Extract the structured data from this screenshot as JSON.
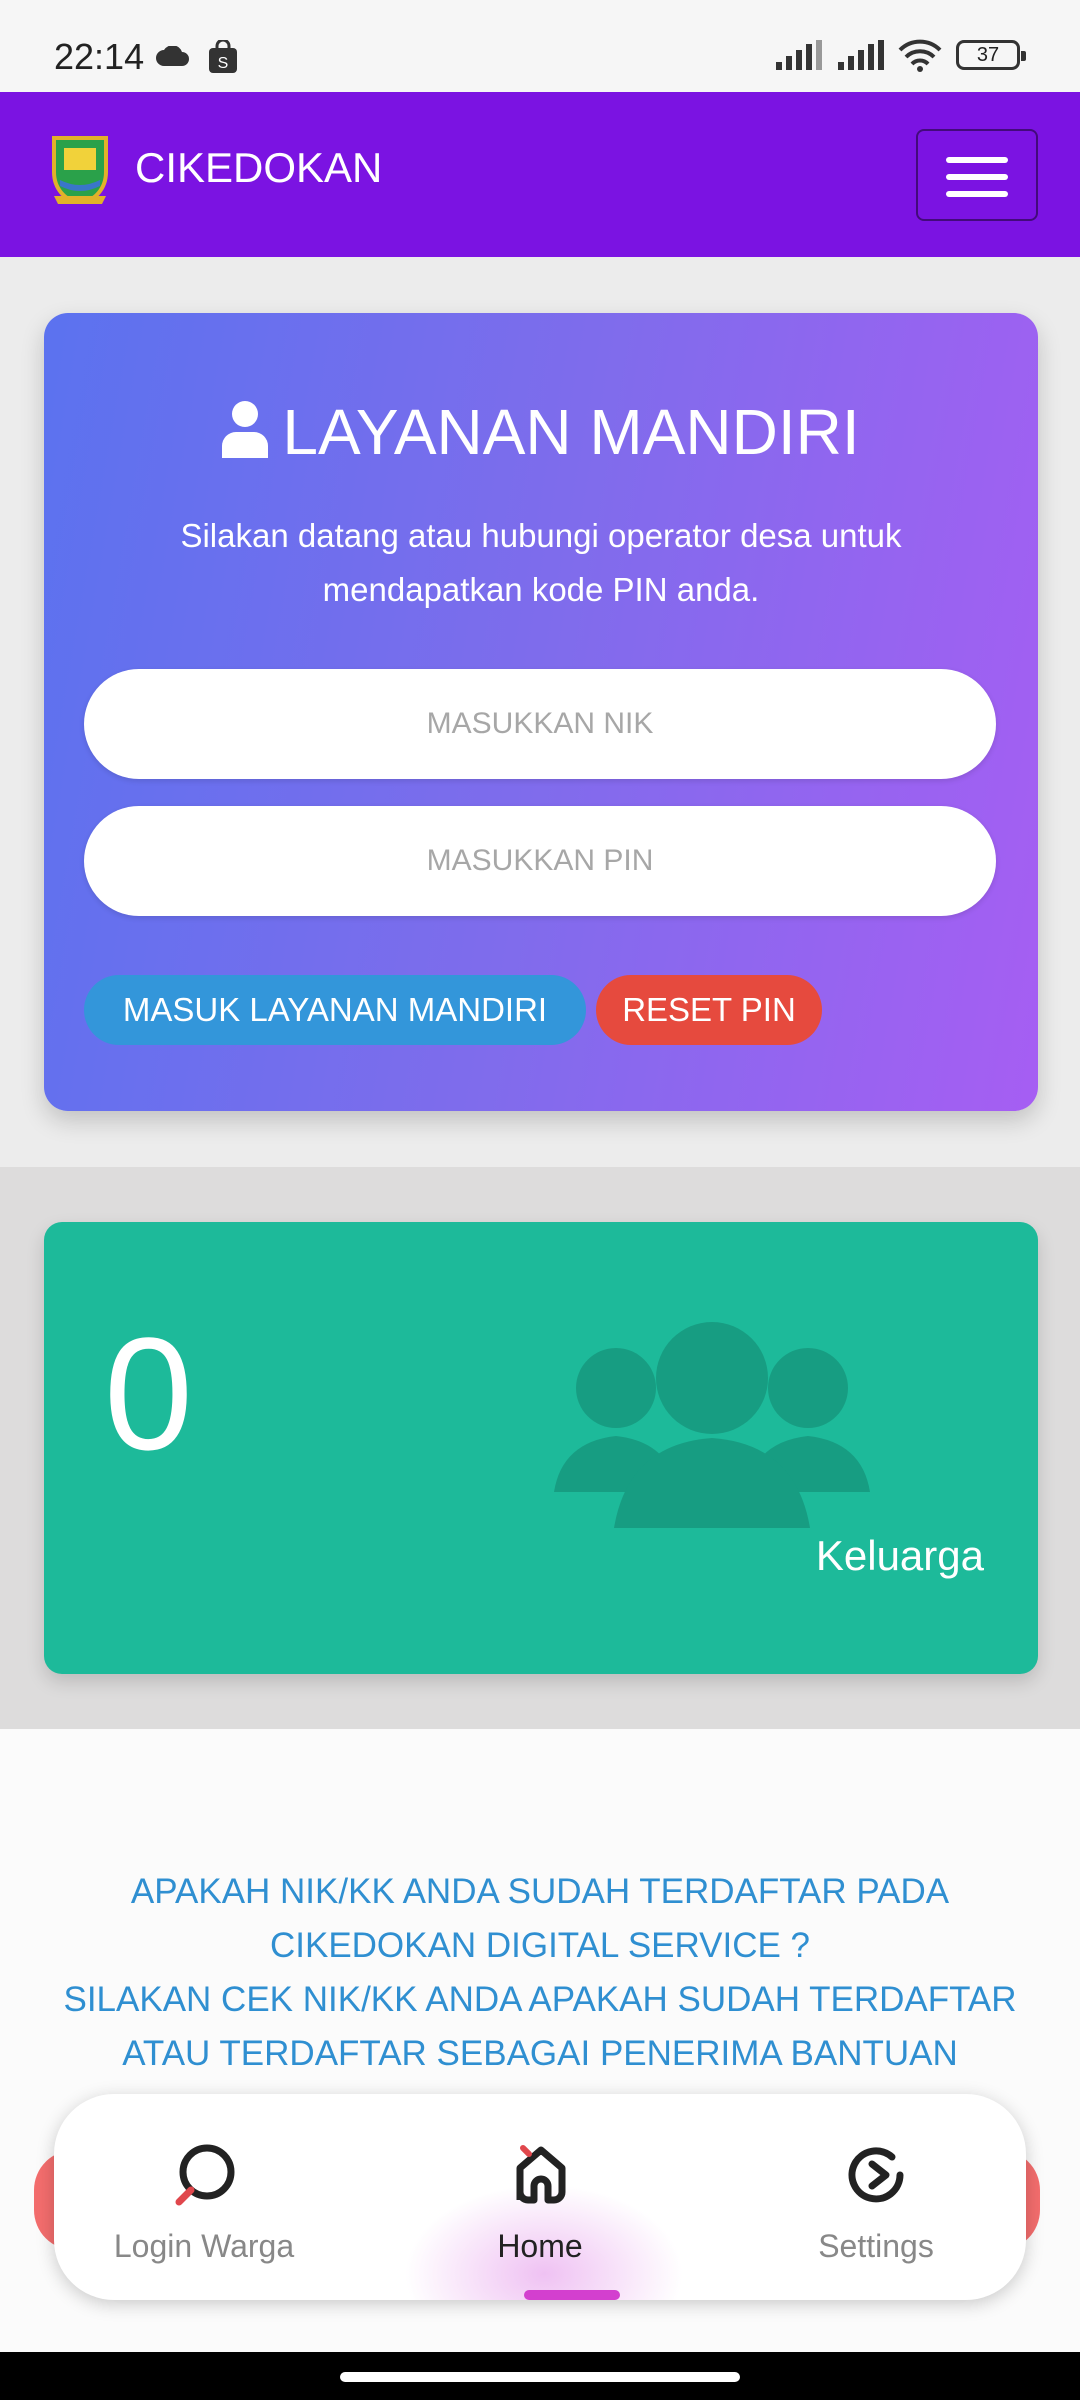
{
  "status_bar": {
    "time": "22:14",
    "battery": "37"
  },
  "header": {
    "title": "CIKEDOKAN"
  },
  "login_card": {
    "title": "LAYANAN MANDIRI",
    "subtitle": "Silakan datang atau hubungi operator desa untuk mendapatkan kode PIN anda.",
    "nik_placeholder": "MASUKKAN NIK",
    "pin_placeholder": "MASUKKAN PIN",
    "login_button": "MASUK LAYANAN MANDIRI",
    "reset_button": "RESET PIN"
  },
  "stat_card": {
    "value": "0",
    "label": "Keluarga"
  },
  "info": {
    "line1": "APAKAH NIK/KK ANDA SUDAH TERDAFTAR PADA",
    "line2": "CIKEDOKAN DIGITAL SERVICE ?",
    "line3": "SILAKAN CEK NIK/KK ANDA APAKAH SUDAH TERDAFTAR",
    "line4": "ATAU TERDAFTAR SEBAGAI PENERIMA BANTUAN"
  },
  "bottom_nav": {
    "items": [
      {
        "label": "Login Warga",
        "icon": "search-icon"
      },
      {
        "label": "Home",
        "icon": "home-icon",
        "active": true
      },
      {
        "label": "Settings",
        "icon": "refresh-icon"
      }
    ]
  },
  "colors": {
    "header": "#7b13e2",
    "card_gradient_start": "#5b72ef",
    "card_gradient_end": "#a65ef3",
    "login_button": "#3396da",
    "reset_button": "#e64a3e",
    "stat_card": "#1dba9a",
    "info_text": "#2f8fd1",
    "nav_active": "#d33fcf"
  }
}
